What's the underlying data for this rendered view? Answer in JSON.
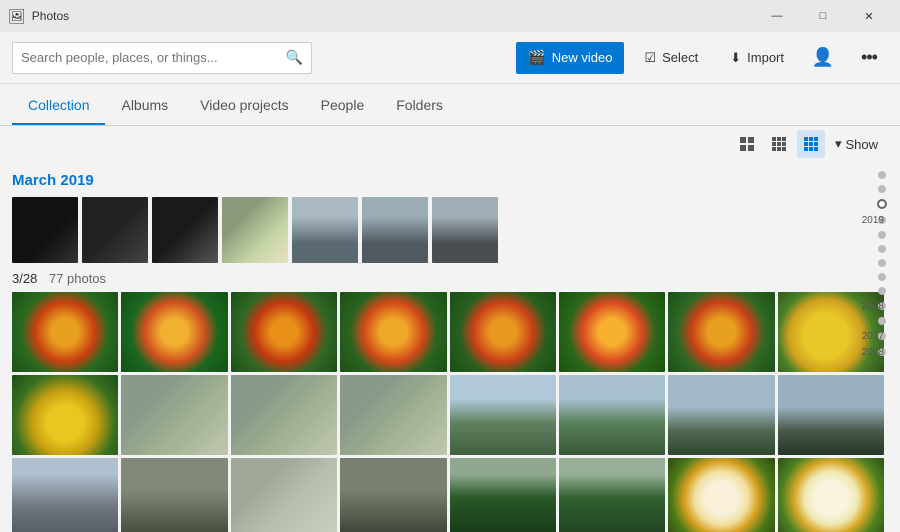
{
  "app": {
    "title": "Photos"
  },
  "titlebar": {
    "title": "Photos",
    "minimize": "—",
    "maximize": "□",
    "close": "✕"
  },
  "toolbar": {
    "search_placeholder": "Search people, places, or things...",
    "new_video": "New video",
    "select": "Select",
    "import": "Import"
  },
  "nav": {
    "tabs": [
      {
        "label": "Collection",
        "active": true
      },
      {
        "label": "Albums",
        "active": false
      },
      {
        "label": "Video projects",
        "active": false
      },
      {
        "label": "People",
        "active": false
      },
      {
        "label": "Folders",
        "active": false
      }
    ]
  },
  "view": {
    "show_label": "Show"
  },
  "content": {
    "section": "March 2019",
    "date_label": "3/28",
    "photo_count": "77 photos"
  },
  "timeline": {
    "years": [
      {
        "year": "2019",
        "offset": 55
      },
      {
        "year": "2018",
        "offset": 155
      },
      {
        "year": "2017",
        "offset": 220
      },
      {
        "year": "2008",
        "offset": 245
      }
    ]
  }
}
